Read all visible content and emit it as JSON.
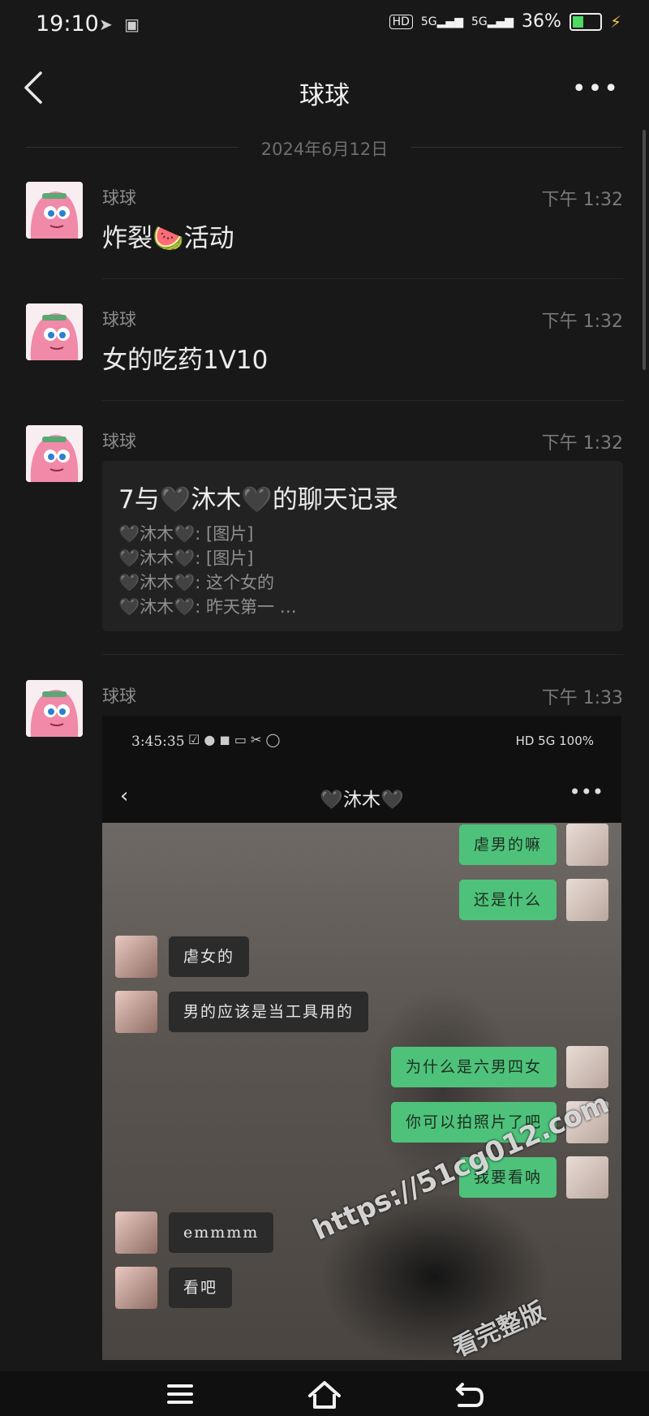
{
  "status_bar": {
    "time": "19:10",
    "left_icons": [
      "telegram-icon",
      "app-icon"
    ],
    "hd_badge": "HD",
    "net1": "5G",
    "net2": "5G",
    "battery": "36%",
    "battery_level": 0.36
  },
  "navbar": {
    "title": "球球"
  },
  "date_divider": "2024年6月12日",
  "messages": [
    {
      "sender": "球球",
      "time": "下午 1:32",
      "text": "炸裂🍉活动"
    },
    {
      "sender": "球球",
      "time": "下午 1:32",
      "text": "女的吃药1V10"
    },
    {
      "sender": "球球",
      "time": "下午 1:32",
      "record": {
        "title": "7与🖤沐木🖤的聊天记录",
        "lines": [
          "🖤沐木🖤: [图片]",
          "🖤沐木🖤: [图片]",
          "🖤沐木🖤: 这个女的",
          "🖤沐木🖤: 昨天第一 …"
        ]
      }
    },
    {
      "sender": "球球",
      "time": "下午 1:33"
    }
  ],
  "screenshot": {
    "status_time": "3:45:35",
    "status_right": "HD 5G 100%",
    "title": "🖤沐木🖤",
    "bubbles": [
      {
        "side": "right",
        "text": "虐男的嘛"
      },
      {
        "side": "right",
        "text": "还是什么"
      },
      {
        "side": "left",
        "text": "虐女的"
      },
      {
        "side": "left",
        "text": "男的应该是当工具用的"
      },
      {
        "side": "right",
        "text": "为什么是六男四女"
      },
      {
        "side": "right",
        "text": "你可以拍照片了吧"
      },
      {
        "side": "right",
        "text": "我要看呐"
      },
      {
        "side": "left",
        "text": "emmmm"
      },
      {
        "side": "left",
        "text": "看吧"
      }
    ]
  },
  "watermark": {
    "url": "https://51cg012.com",
    "caption": "看完整版"
  },
  "colors": {
    "bg": "#181818",
    "bubble_green": "#4ec27a",
    "bubble_dark": "#2b2b2b"
  }
}
